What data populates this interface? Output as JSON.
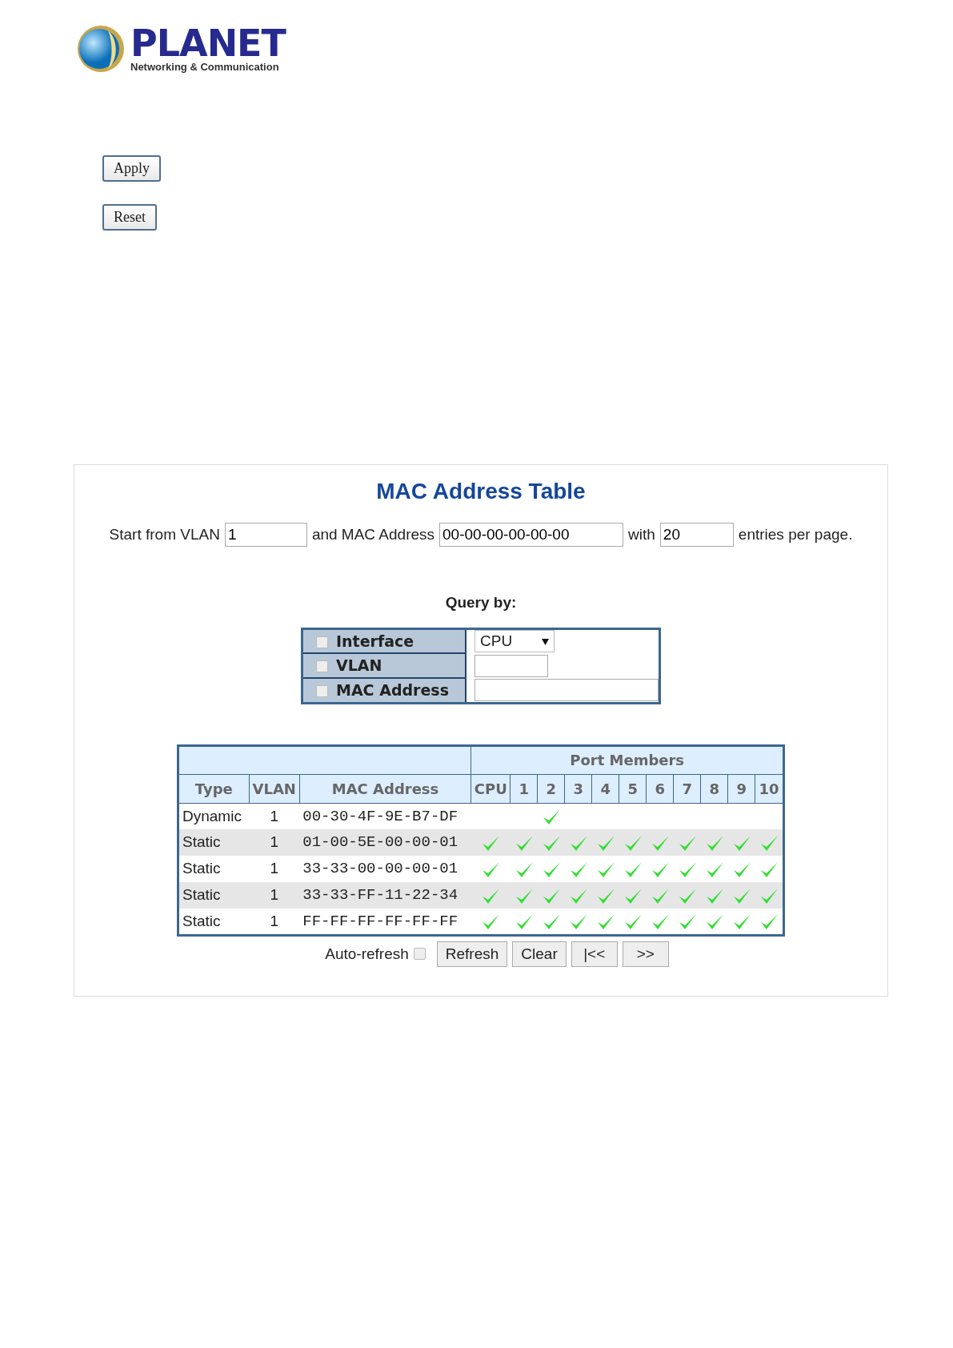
{
  "logo": {
    "brand": "PLANET",
    "tagline": "Networking & Communication"
  },
  "buttons": [
    "Apply",
    "Reset"
  ],
  "panel": {
    "title": "MAC Address Table",
    "start_row": [
      {
        "kind": "text",
        "text": "Start from VLAN"
      },
      {
        "kind": "input",
        "value": "1"
      },
      {
        "kind": "text",
        "text": "and MAC Address"
      },
      {
        "kind": "input",
        "value": "00-00-00-00-00-00"
      },
      {
        "kind": "text",
        "text": "with"
      },
      {
        "kind": "input",
        "value": "20"
      },
      {
        "kind": "text",
        "text": "entries per page."
      }
    ],
    "query_title": "Query by:",
    "query": [
      {
        "label": "Interface",
        "checked": false,
        "kind": "select",
        "value": "CPU"
      },
      {
        "label": "VLAN",
        "checked": false,
        "kind": "input"
      },
      {
        "label": "MAC Address",
        "checked": false,
        "kind": "input"
      }
    ],
    "table": {
      "group_header": "Port Members",
      "columns": [
        "Type",
        "VLAN",
        "MAC Address"
      ],
      "port_columns": [
        "CPU",
        "1",
        "2",
        "3",
        "4",
        "5",
        "6",
        "7",
        "8",
        "9",
        "10"
      ],
      "rows": [
        {
          "type": "Dynamic",
          "vlan": "1",
          "mac": "00-30-4F-9E-B7-DF",
          "members": [
            false,
            false,
            true,
            false,
            false,
            false,
            false,
            false,
            false,
            false,
            false
          ]
        },
        {
          "type": "Static",
          "vlan": "1",
          "mac": "01-00-5E-00-00-01",
          "members": [
            true,
            true,
            true,
            true,
            true,
            true,
            true,
            true,
            true,
            true,
            true
          ]
        },
        {
          "type": "Static",
          "vlan": "1",
          "mac": "33-33-00-00-00-01",
          "members": [
            true,
            true,
            true,
            true,
            true,
            true,
            true,
            true,
            true,
            true,
            true
          ]
        },
        {
          "type": "Static",
          "vlan": "1",
          "mac": "33-33-FF-11-22-34",
          "members": [
            true,
            true,
            true,
            true,
            true,
            true,
            true,
            true,
            true,
            true,
            true
          ]
        },
        {
          "type": "Static",
          "vlan": "1",
          "mac": "FF-FF-FF-FF-FF-FF",
          "members": [
            true,
            true,
            true,
            true,
            true,
            true,
            true,
            true,
            true,
            true,
            true
          ]
        }
      ]
    },
    "auto_refresh": {
      "label": "Auto-refresh",
      "checked": false
    },
    "actions": [
      "Refresh",
      "Clear",
      "|<<",
      ">>"
    ]
  }
}
